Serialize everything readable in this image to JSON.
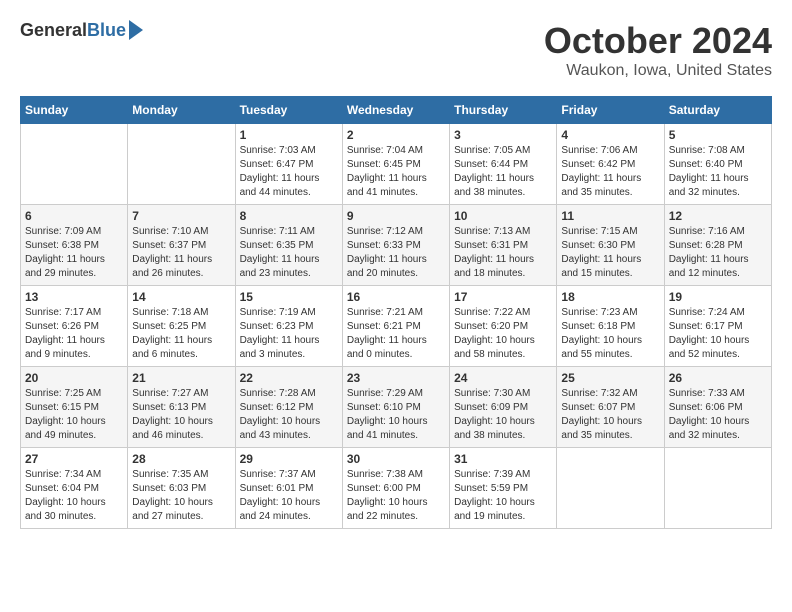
{
  "header": {
    "logo_general": "General",
    "logo_blue": "Blue",
    "month_title": "October 2024",
    "location": "Waukon, Iowa, United States"
  },
  "calendar": {
    "days_of_week": [
      "Sunday",
      "Monday",
      "Tuesday",
      "Wednesday",
      "Thursday",
      "Friday",
      "Saturday"
    ],
    "weeks": [
      [
        {
          "day": "",
          "info": ""
        },
        {
          "day": "",
          "info": ""
        },
        {
          "day": "1",
          "info": "Sunrise: 7:03 AM\nSunset: 6:47 PM\nDaylight: 11 hours and 44 minutes."
        },
        {
          "day": "2",
          "info": "Sunrise: 7:04 AM\nSunset: 6:45 PM\nDaylight: 11 hours and 41 minutes."
        },
        {
          "day": "3",
          "info": "Sunrise: 7:05 AM\nSunset: 6:44 PM\nDaylight: 11 hours and 38 minutes."
        },
        {
          "day": "4",
          "info": "Sunrise: 7:06 AM\nSunset: 6:42 PM\nDaylight: 11 hours and 35 minutes."
        },
        {
          "day": "5",
          "info": "Sunrise: 7:08 AM\nSunset: 6:40 PM\nDaylight: 11 hours and 32 minutes."
        }
      ],
      [
        {
          "day": "6",
          "info": "Sunrise: 7:09 AM\nSunset: 6:38 PM\nDaylight: 11 hours and 29 minutes."
        },
        {
          "day": "7",
          "info": "Sunrise: 7:10 AM\nSunset: 6:37 PM\nDaylight: 11 hours and 26 minutes."
        },
        {
          "day": "8",
          "info": "Sunrise: 7:11 AM\nSunset: 6:35 PM\nDaylight: 11 hours and 23 minutes."
        },
        {
          "day": "9",
          "info": "Sunrise: 7:12 AM\nSunset: 6:33 PM\nDaylight: 11 hours and 20 minutes."
        },
        {
          "day": "10",
          "info": "Sunrise: 7:13 AM\nSunset: 6:31 PM\nDaylight: 11 hours and 18 minutes."
        },
        {
          "day": "11",
          "info": "Sunrise: 7:15 AM\nSunset: 6:30 PM\nDaylight: 11 hours and 15 minutes."
        },
        {
          "day": "12",
          "info": "Sunrise: 7:16 AM\nSunset: 6:28 PM\nDaylight: 11 hours and 12 minutes."
        }
      ],
      [
        {
          "day": "13",
          "info": "Sunrise: 7:17 AM\nSunset: 6:26 PM\nDaylight: 11 hours and 9 minutes."
        },
        {
          "day": "14",
          "info": "Sunrise: 7:18 AM\nSunset: 6:25 PM\nDaylight: 11 hours and 6 minutes."
        },
        {
          "day": "15",
          "info": "Sunrise: 7:19 AM\nSunset: 6:23 PM\nDaylight: 11 hours and 3 minutes."
        },
        {
          "day": "16",
          "info": "Sunrise: 7:21 AM\nSunset: 6:21 PM\nDaylight: 11 hours and 0 minutes."
        },
        {
          "day": "17",
          "info": "Sunrise: 7:22 AM\nSunset: 6:20 PM\nDaylight: 10 hours and 58 minutes."
        },
        {
          "day": "18",
          "info": "Sunrise: 7:23 AM\nSunset: 6:18 PM\nDaylight: 10 hours and 55 minutes."
        },
        {
          "day": "19",
          "info": "Sunrise: 7:24 AM\nSunset: 6:17 PM\nDaylight: 10 hours and 52 minutes."
        }
      ],
      [
        {
          "day": "20",
          "info": "Sunrise: 7:25 AM\nSunset: 6:15 PM\nDaylight: 10 hours and 49 minutes."
        },
        {
          "day": "21",
          "info": "Sunrise: 7:27 AM\nSunset: 6:13 PM\nDaylight: 10 hours and 46 minutes."
        },
        {
          "day": "22",
          "info": "Sunrise: 7:28 AM\nSunset: 6:12 PM\nDaylight: 10 hours and 43 minutes."
        },
        {
          "day": "23",
          "info": "Sunrise: 7:29 AM\nSunset: 6:10 PM\nDaylight: 10 hours and 41 minutes."
        },
        {
          "day": "24",
          "info": "Sunrise: 7:30 AM\nSunset: 6:09 PM\nDaylight: 10 hours and 38 minutes."
        },
        {
          "day": "25",
          "info": "Sunrise: 7:32 AM\nSunset: 6:07 PM\nDaylight: 10 hours and 35 minutes."
        },
        {
          "day": "26",
          "info": "Sunrise: 7:33 AM\nSunset: 6:06 PM\nDaylight: 10 hours and 32 minutes."
        }
      ],
      [
        {
          "day": "27",
          "info": "Sunrise: 7:34 AM\nSunset: 6:04 PM\nDaylight: 10 hours and 30 minutes."
        },
        {
          "day": "28",
          "info": "Sunrise: 7:35 AM\nSunset: 6:03 PM\nDaylight: 10 hours and 27 minutes."
        },
        {
          "day": "29",
          "info": "Sunrise: 7:37 AM\nSunset: 6:01 PM\nDaylight: 10 hours and 24 minutes."
        },
        {
          "day": "30",
          "info": "Sunrise: 7:38 AM\nSunset: 6:00 PM\nDaylight: 10 hours and 22 minutes."
        },
        {
          "day": "31",
          "info": "Sunrise: 7:39 AM\nSunset: 5:59 PM\nDaylight: 10 hours and 19 minutes."
        },
        {
          "day": "",
          "info": ""
        },
        {
          "day": "",
          "info": ""
        }
      ]
    ]
  }
}
